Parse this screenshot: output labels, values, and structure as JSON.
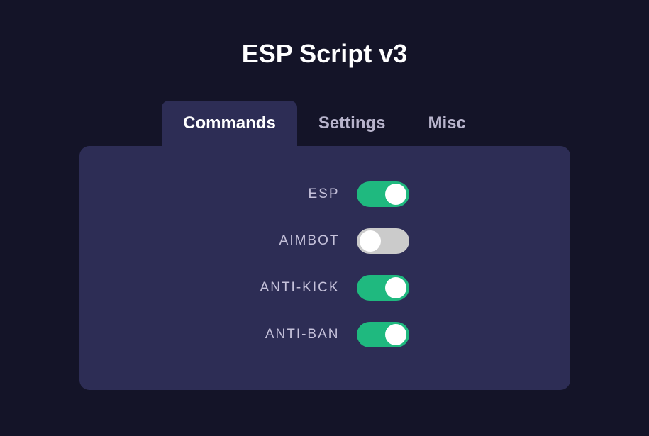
{
  "title": "ESP Script v3",
  "tabs": [
    {
      "label": "Commands",
      "active": true
    },
    {
      "label": "Settings",
      "active": false
    },
    {
      "label": "Misc",
      "active": false
    }
  ],
  "commands": [
    {
      "label": "ESP",
      "enabled": true
    },
    {
      "label": "AIMBOT",
      "enabled": false
    },
    {
      "label": "ANTI-KICK",
      "enabled": true
    },
    {
      "label": "ANTI-BAN",
      "enabled": true
    }
  ],
  "colors": {
    "background": "#141428",
    "panel": "#2d2d55",
    "toggle_on": "#1fb97f",
    "toggle_off": "#cbcbcb"
  }
}
